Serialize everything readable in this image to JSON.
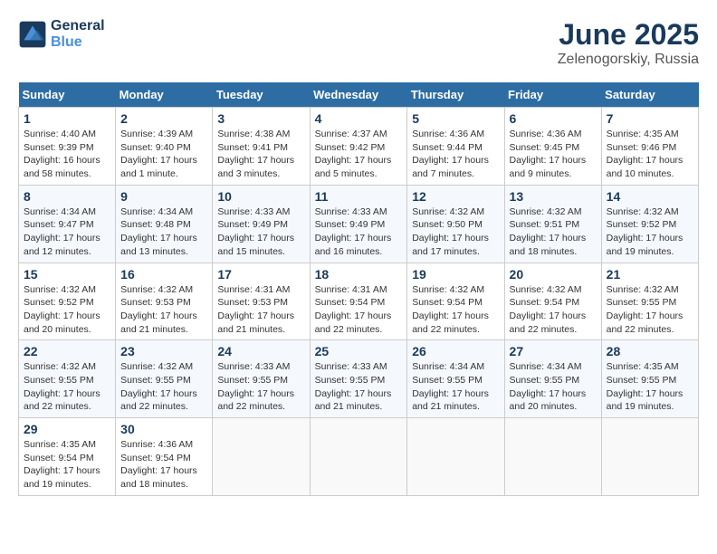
{
  "header": {
    "logo_line1": "General",
    "logo_line2": "Blue",
    "month": "June 2025",
    "location": "Zelenogorskiy, Russia"
  },
  "weekdays": [
    "Sunday",
    "Monday",
    "Tuesday",
    "Wednesday",
    "Thursday",
    "Friday",
    "Saturday"
  ],
  "weeks": [
    [
      {
        "day": "1",
        "info": "Sunrise: 4:40 AM\nSunset: 9:39 PM\nDaylight: 16 hours\nand 58 minutes."
      },
      {
        "day": "2",
        "info": "Sunrise: 4:39 AM\nSunset: 9:40 PM\nDaylight: 17 hours\nand 1 minute."
      },
      {
        "day": "3",
        "info": "Sunrise: 4:38 AM\nSunset: 9:41 PM\nDaylight: 17 hours\nand 3 minutes."
      },
      {
        "day": "4",
        "info": "Sunrise: 4:37 AM\nSunset: 9:42 PM\nDaylight: 17 hours\nand 5 minutes."
      },
      {
        "day": "5",
        "info": "Sunrise: 4:36 AM\nSunset: 9:44 PM\nDaylight: 17 hours\nand 7 minutes."
      },
      {
        "day": "6",
        "info": "Sunrise: 4:36 AM\nSunset: 9:45 PM\nDaylight: 17 hours\nand 9 minutes."
      },
      {
        "day": "7",
        "info": "Sunrise: 4:35 AM\nSunset: 9:46 PM\nDaylight: 17 hours\nand 10 minutes."
      }
    ],
    [
      {
        "day": "8",
        "info": "Sunrise: 4:34 AM\nSunset: 9:47 PM\nDaylight: 17 hours\nand 12 minutes."
      },
      {
        "day": "9",
        "info": "Sunrise: 4:34 AM\nSunset: 9:48 PM\nDaylight: 17 hours\nand 13 minutes."
      },
      {
        "day": "10",
        "info": "Sunrise: 4:33 AM\nSunset: 9:49 PM\nDaylight: 17 hours\nand 15 minutes."
      },
      {
        "day": "11",
        "info": "Sunrise: 4:33 AM\nSunset: 9:49 PM\nDaylight: 17 hours\nand 16 minutes."
      },
      {
        "day": "12",
        "info": "Sunrise: 4:32 AM\nSunset: 9:50 PM\nDaylight: 17 hours\nand 17 minutes."
      },
      {
        "day": "13",
        "info": "Sunrise: 4:32 AM\nSunset: 9:51 PM\nDaylight: 17 hours\nand 18 minutes."
      },
      {
        "day": "14",
        "info": "Sunrise: 4:32 AM\nSunset: 9:52 PM\nDaylight: 17 hours\nand 19 minutes."
      }
    ],
    [
      {
        "day": "15",
        "info": "Sunrise: 4:32 AM\nSunset: 9:52 PM\nDaylight: 17 hours\nand 20 minutes."
      },
      {
        "day": "16",
        "info": "Sunrise: 4:32 AM\nSunset: 9:53 PM\nDaylight: 17 hours\nand 21 minutes."
      },
      {
        "day": "17",
        "info": "Sunrise: 4:31 AM\nSunset: 9:53 PM\nDaylight: 17 hours\nand 21 minutes."
      },
      {
        "day": "18",
        "info": "Sunrise: 4:31 AM\nSunset: 9:54 PM\nDaylight: 17 hours\nand 22 minutes."
      },
      {
        "day": "19",
        "info": "Sunrise: 4:32 AM\nSunset: 9:54 PM\nDaylight: 17 hours\nand 22 minutes."
      },
      {
        "day": "20",
        "info": "Sunrise: 4:32 AM\nSunset: 9:54 PM\nDaylight: 17 hours\nand 22 minutes."
      },
      {
        "day": "21",
        "info": "Sunrise: 4:32 AM\nSunset: 9:55 PM\nDaylight: 17 hours\nand 22 minutes."
      }
    ],
    [
      {
        "day": "22",
        "info": "Sunrise: 4:32 AM\nSunset: 9:55 PM\nDaylight: 17 hours\nand 22 minutes."
      },
      {
        "day": "23",
        "info": "Sunrise: 4:32 AM\nSunset: 9:55 PM\nDaylight: 17 hours\nand 22 minutes."
      },
      {
        "day": "24",
        "info": "Sunrise: 4:33 AM\nSunset: 9:55 PM\nDaylight: 17 hours\nand 22 minutes."
      },
      {
        "day": "25",
        "info": "Sunrise: 4:33 AM\nSunset: 9:55 PM\nDaylight: 17 hours\nand 21 minutes."
      },
      {
        "day": "26",
        "info": "Sunrise: 4:34 AM\nSunset: 9:55 PM\nDaylight: 17 hours\nand 21 minutes."
      },
      {
        "day": "27",
        "info": "Sunrise: 4:34 AM\nSunset: 9:55 PM\nDaylight: 17 hours\nand 20 minutes."
      },
      {
        "day": "28",
        "info": "Sunrise: 4:35 AM\nSunset: 9:55 PM\nDaylight: 17 hours\nand 19 minutes."
      }
    ],
    [
      {
        "day": "29",
        "info": "Sunrise: 4:35 AM\nSunset: 9:54 PM\nDaylight: 17 hours\nand 19 minutes."
      },
      {
        "day": "30",
        "info": "Sunrise: 4:36 AM\nSunset: 9:54 PM\nDaylight: 17 hours\nand 18 minutes."
      },
      null,
      null,
      null,
      null,
      null
    ]
  ]
}
